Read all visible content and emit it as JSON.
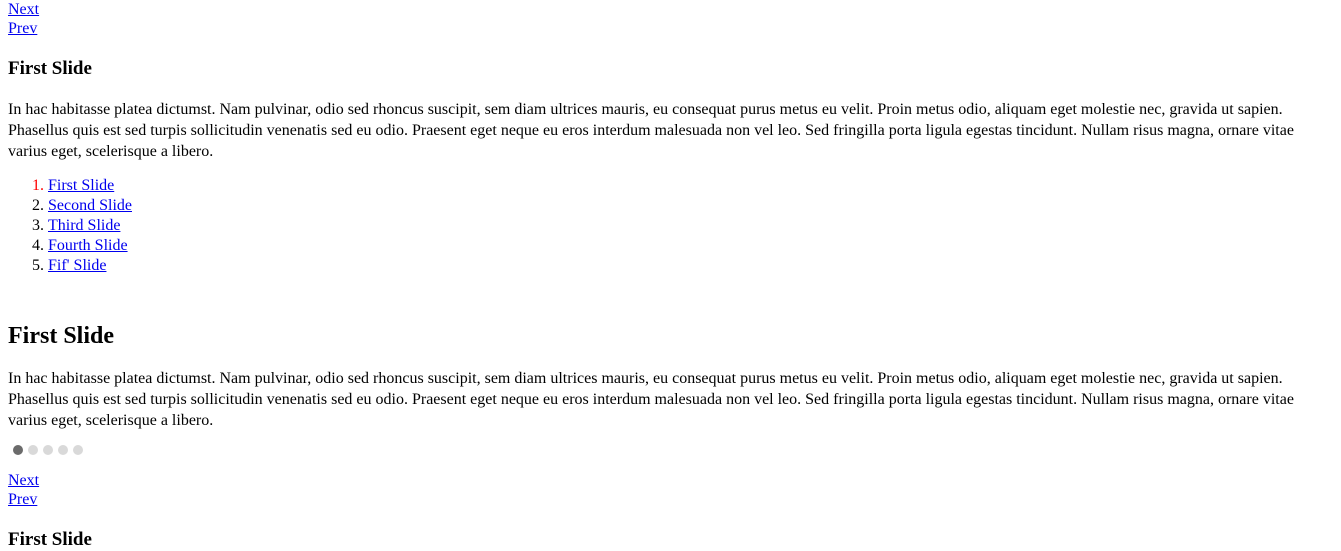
{
  "nav_top": {
    "next_label": "Next",
    "prev_label": "Prev"
  },
  "nav_bottom": {
    "next_label": "Next",
    "prev_label": "Prev"
  },
  "heading_top": "First Slide",
  "heading_middle": "First Slide",
  "heading_bottom": "First Slide",
  "paragraph_top": "In hac habitasse platea dictumst. Nam pulvinar, odio sed rhoncus suscipit, sem diam ultrices mauris, eu consequat purus metus eu velit. Proin metus odio, aliquam eget molestie nec, gravida ut sapien. Phasellus quis est sed turpis sollicitudin venenatis sed eu odio. Praesent eget neque eu eros interdum malesuada non vel leo. Sed fringilla porta ligula egestas tincidunt. Nullam risus magna, ornare vitae varius eget, scelerisque a libero.",
  "paragraph_middle": "In hac habitasse platea dictumst. Nam pulvinar, odio sed rhoncus suscipit, sem diam ultrices mauris, eu consequat purus metus eu velit. Proin metus odio, aliquam eget molestie nec, gravida ut sapien. Phasellus quis est sed turpis sollicitudin venenatis sed eu odio. Praesent eget neque eu eros interdum malesuada non vel leo. Sed fringilla porta ligula egestas tincidunt. Nullam risus magna, ornare vitae varius eget, scelerisque a libero.",
  "slide_list": {
    "items": [
      {
        "number": "1.",
        "label": "First Slide",
        "active": true
      },
      {
        "number": "2.",
        "label": "Second Slide",
        "active": false
      },
      {
        "number": "3.",
        "label": "Third Slide",
        "active": false
      },
      {
        "number": "4.",
        "label": "Fourth Slide",
        "active": false
      },
      {
        "number": "5.",
        "label": "Fif' Slide",
        "active": false
      }
    ]
  },
  "dots": {
    "count": 5,
    "active_index": 0
  },
  "colors": {
    "link": "#0000ee",
    "active_marker": "#ff0000",
    "dot_active": "#6b6b6b",
    "dot_inactive": "#d9d9d9",
    "text": "#000000",
    "background": "#ffffff"
  }
}
